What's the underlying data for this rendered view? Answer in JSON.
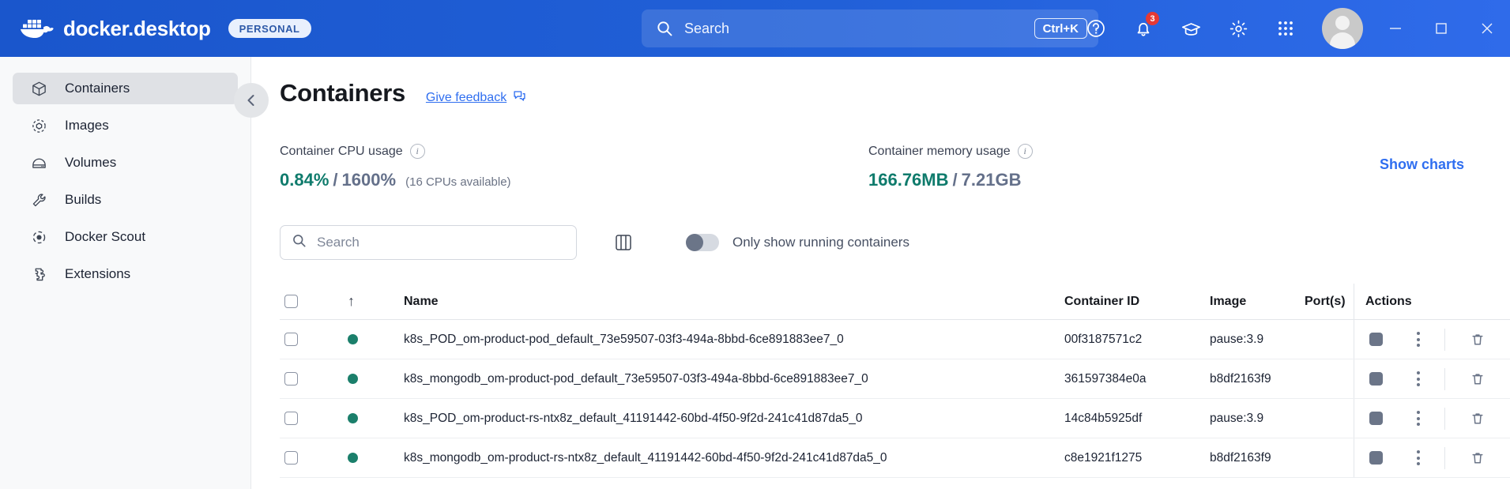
{
  "titlebar": {
    "brand_docker": "docker",
    "brand_sep": ".",
    "brand_desktop": "desktop",
    "plan_badge": "PERSONAL",
    "search_placeholder": "Search",
    "search_shortcut": "Ctrl+K",
    "icons": {
      "help": "help-icon",
      "notifications": "bell-icon",
      "notification_count": "3",
      "learning": "graduation-cap-icon",
      "settings": "gear-icon",
      "apps": "grid-apps-icon",
      "avatar": "user-avatar",
      "minimize": "minimize-icon",
      "maximize": "maximize-icon",
      "close": "close-icon"
    }
  },
  "sidebar": {
    "items": [
      {
        "label": "Containers",
        "icon": "cube-icon",
        "active": true
      },
      {
        "label": "Images",
        "icon": "images-icon",
        "active": false
      },
      {
        "label": "Volumes",
        "icon": "volumes-icon",
        "active": false
      },
      {
        "label": "Builds",
        "icon": "wrench-icon",
        "active": false
      },
      {
        "label": "Docker Scout",
        "icon": "scout-icon",
        "active": false
      },
      {
        "label": "Extensions",
        "icon": "puzzle-icon",
        "active": false
      }
    ]
  },
  "main": {
    "collapse_icon": "chevron-left-icon",
    "page_title": "Containers",
    "feedback_link": "Give feedback",
    "feedback_icon": "external-feedback-icon",
    "stats": {
      "cpu": {
        "label": "Container CPU usage",
        "info_icon": "info-icon",
        "used": "0.84%",
        "separator": "/",
        "total": "1600%",
        "note": "(16 CPUs available)"
      },
      "memory": {
        "label": "Container memory usage",
        "info_icon": "info-icon",
        "used": "166.76MB",
        "separator": "/",
        "total": "7.21GB",
        "note": ""
      },
      "show_charts": "Show charts"
    },
    "controls": {
      "search_placeholder": "Search",
      "search_icon": "search-icon",
      "columns_icon": "columns-icon",
      "toggle_label": "Only show running containers",
      "toggle_on": false
    },
    "table": {
      "headers": {
        "select_all": "",
        "sort": "↑",
        "name": "Name",
        "container_id": "Container ID",
        "image": "Image",
        "ports": "Port(s)",
        "actions": "Actions"
      },
      "rows": [
        {
          "name": "k8s_POD_om-product-pod_default_73e59507-03f3-494a-8bbd-6ce891883ee7_0",
          "container_id": "00f3187571c2",
          "image": "pause:3.9",
          "ports": "",
          "status": "running",
          "status_color": "#1b7f6b"
        },
        {
          "name": "k8s_mongodb_om-product-pod_default_73e59507-03f3-494a-8bbd-6ce891883ee7_0",
          "container_id": "361597384e0a",
          "image": "b8df2163f9",
          "ports": "",
          "status": "running",
          "status_color": "#1b7f6b"
        },
        {
          "name": "k8s_POD_om-product-rs-ntx8z_default_41191442-60bd-4f50-9f2d-241c41d87da5_0",
          "container_id": "14c84b5925df",
          "image": "pause:3.9",
          "ports": "",
          "status": "running",
          "status_color": "#1b7f6b"
        },
        {
          "name": "k8s_mongodb_om-product-rs-ntx8z_default_41191442-60bd-4f50-9f2d-241c41d87da5_0",
          "container_id": "c8e1921f1275",
          "image": "b8df2163f9",
          "ports": "",
          "status": "running",
          "status_color": "#1b7f6b"
        }
      ],
      "row_actions": {
        "stop": "stop-button",
        "more": "more-options-button",
        "delete": "delete-button"
      }
    }
  },
  "colors": {
    "titlebar_blue": "#2160d8",
    "accent_link": "#2f6ef0",
    "stat_used": "#0f7b6c",
    "status_running": "#1b7f6b",
    "sidebar_bg": "#f8f9fa",
    "badge_red": "#e53935"
  }
}
